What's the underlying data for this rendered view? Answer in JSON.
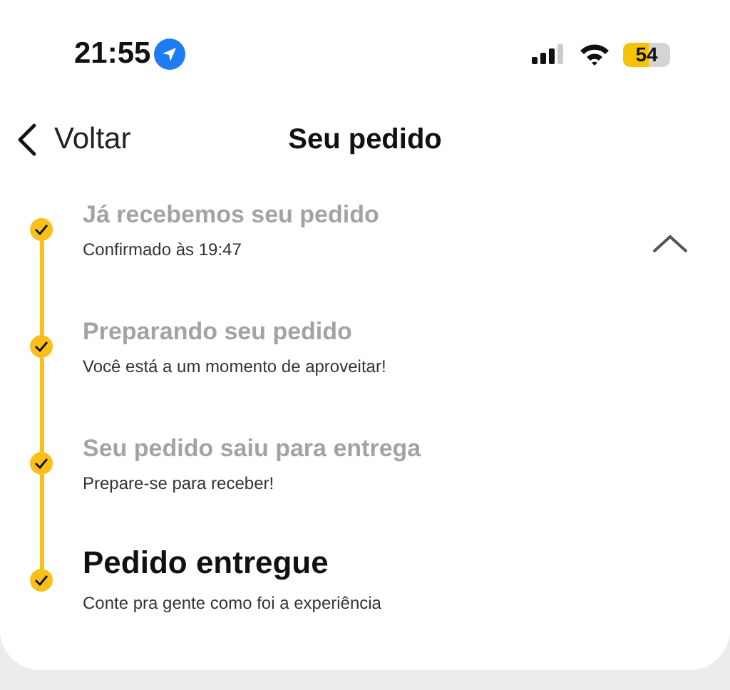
{
  "status_bar": {
    "time": "21:55",
    "battery": "54"
  },
  "nav": {
    "back": "Voltar",
    "title": "Seu pedido"
  },
  "order_status": {
    "expanded": true,
    "steps": [
      {
        "title": "Já recebemos seu pedido",
        "subtitle": "Confirmado às 19:47",
        "done": true,
        "current": false
      },
      {
        "title": "Preparando seu pedido",
        "subtitle": "Você está a um momento de aproveitar!",
        "done": true,
        "current": false
      },
      {
        "title": "Seu pedido saiu para entrega",
        "subtitle": "Prepare-se para receber!",
        "done": true,
        "current": false
      },
      {
        "title": "Pedido entregue",
        "subtitle": "Conte pra gente como foi a experiência",
        "done": true,
        "current": true
      }
    ]
  }
}
